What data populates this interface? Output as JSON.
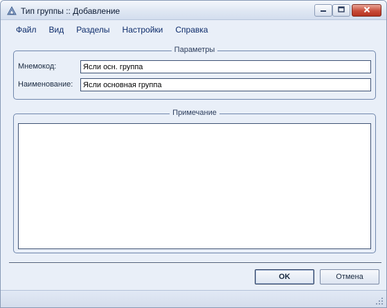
{
  "window": {
    "title": "Тип группы :: Добавление"
  },
  "menu": {
    "items": [
      {
        "label": "Файл"
      },
      {
        "label": "Вид"
      },
      {
        "label": "Разделы"
      },
      {
        "label": "Настройки"
      },
      {
        "label": "Справка"
      }
    ]
  },
  "params": {
    "legend": "Параметры",
    "mnemocode_label": "Мнемокод:",
    "mnemocode_value": "Ясли осн. группа",
    "name_label": "Наименование:",
    "name_value": "Ясли основная группа"
  },
  "note": {
    "legend": "Примечание",
    "value": ""
  },
  "buttons": {
    "ok": "OK",
    "cancel": "Отмена"
  },
  "icons": {
    "app": "app-icon",
    "minimize": "minimize-icon",
    "maximize": "maximize-icon",
    "close": "close-icon",
    "resize_grip": "resize-grip-icon"
  },
  "colors": {
    "window_bg": "#e9eff8",
    "close_button": "#c84c3a",
    "menu_text": "#0c2b6a"
  }
}
